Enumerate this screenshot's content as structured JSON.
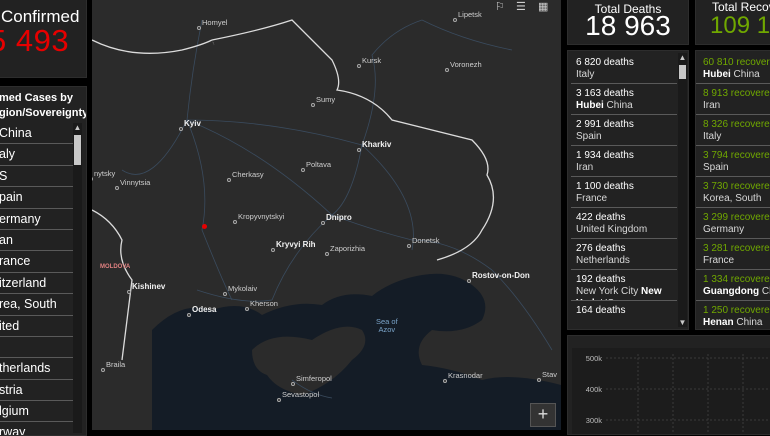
{
  "left": {
    "confirmed_title": "Confirmed",
    "confirmed_value": "5 493",
    "list_header_line1": "med Cases by",
    "list_header_line2": "gion/Sovereignty",
    "countries": [
      "China",
      "aly",
      "S",
      "pain",
      "ermany",
      "an",
      "rance",
      "itzerland",
      "rea, South",
      "ited",
      "",
      "therlands",
      "stria",
      "lgium",
      "rway"
    ]
  },
  "map": {
    "cities": [
      {
        "name": "Homyel",
        "big": false
      },
      {
        "name": "Lipetsk",
        "big": false
      },
      {
        "name": "Kursk",
        "big": false
      },
      {
        "name": "Voronezh",
        "big": false
      },
      {
        "name": "Kyiv",
        "big": true
      },
      {
        "name": "Sumy",
        "big": false
      },
      {
        "name": "Kharkiv",
        "big": true
      },
      {
        "name": "Poltava",
        "big": false
      },
      {
        "name": "Cherkasy",
        "big": false
      },
      {
        "name": "Vinnytsia",
        "big": false
      },
      {
        "name": "Kropyvnytskyi",
        "big": false
      },
      {
        "name": "Dnipro",
        "big": true
      },
      {
        "name": "Kryvyi Rih",
        "big": true
      },
      {
        "name": "Zaporizhia",
        "big": false
      },
      {
        "name": "Donetsk",
        "big": false
      },
      {
        "name": "Rostov-on-Don",
        "big": true
      },
      {
        "name": "Kishinev",
        "big": true
      },
      {
        "name": "Mykolaiv",
        "big": false
      },
      {
        "name": "Odesa",
        "big": true
      },
      {
        "name": "Kherson",
        "big": false
      },
      {
        "name": "Simferopol",
        "big": false
      },
      {
        "name": "Krasnodar",
        "big": false
      },
      {
        "name": "Sevastopol",
        "big": false
      },
      {
        "name": "Stav",
        "big": false
      },
      {
        "name": "nytsky",
        "big": false
      },
      {
        "name": "Braila",
        "big": false
      }
    ],
    "country_label": "MOLDOVA",
    "sea_label_line1": "Sea of",
    "sea_label_line2": "Azov",
    "zoom_in": "+",
    "icons": [
      "bookmark-icon",
      "list-icon",
      "grid-icon"
    ]
  },
  "deaths": {
    "title": "Total Deaths",
    "value": "18 963",
    "items": [
      {
        "value": "6 820 deaths",
        "place": "Italy",
        "bold": ""
      },
      {
        "value": "3 163 deaths",
        "place": " China",
        "bold": "Hubei"
      },
      {
        "value": "2 991 deaths",
        "place": "Spain",
        "bold": ""
      },
      {
        "value": "1 934 deaths",
        "place": "Iran",
        "bold": ""
      },
      {
        "value": "1 100 deaths",
        "place": "France",
        "bold": ""
      },
      {
        "value": "422 deaths",
        "place": "United Kingdom",
        "bold": ""
      },
      {
        "value": "276 deaths",
        "place": "Netherlands",
        "bold": ""
      },
      {
        "value": "192 deaths",
        "place": "New York City ",
        "bold": "New York",
        "suffix": " US"
      },
      {
        "value": "164 deaths",
        "place": "",
        "bold": ""
      }
    ]
  },
  "recovered": {
    "title": "Total Recove",
    "value": "109 1",
    "items": [
      {
        "value": "60 810 recovere",
        "bold": "Hubei",
        "place": " China"
      },
      {
        "value": "8 913 recovered",
        "bold": "",
        "place": "Iran"
      },
      {
        "value": "8 326 recovere",
        "bold": "",
        "place": "Italy"
      },
      {
        "value": "3 794 recovere",
        "bold": "",
        "place": "Spain"
      },
      {
        "value": "3 730 recovere",
        "bold": "",
        "place": "Korea, South"
      },
      {
        "value": "3 299 recovere",
        "bold": "",
        "place": "Germany"
      },
      {
        "value": "3 281 recovere",
        "bold": "",
        "place": "France"
      },
      {
        "value": "1 334 recovere",
        "bold": "Guangdong",
        "place": " Ch"
      },
      {
        "value": "1 250 recovere",
        "bold": "Henan",
        "place": " China"
      }
    ]
  },
  "chart_data": {
    "type": "line",
    "title": "",
    "xlabel": "",
    "ylabel": "",
    "y_ticks": [
      "500k",
      "400k",
      "300k"
    ],
    "ylim": [
      250000,
      500000
    ],
    "grid": true,
    "series": []
  },
  "colors": {
    "confirmed_red": "#e60000",
    "recovered_green": "#70a800",
    "panel_bg": "#222222"
  }
}
